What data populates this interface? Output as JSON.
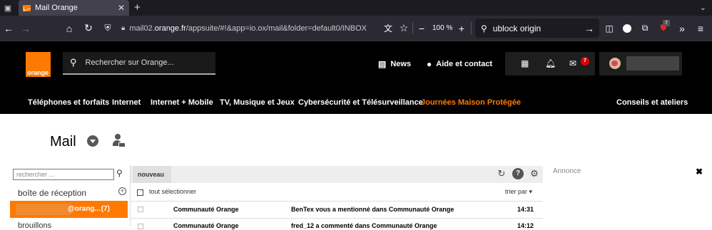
{
  "browser": {
    "tab_title": "Mail Orange",
    "tab_close": "✕",
    "new_tab": "+",
    "url_prefix": "mail02.",
    "url_domain": "orange.fr",
    "url_rest": "/appsuite/#!&app=io.ox/mail&folder=default0/INBOX",
    "zoom": "100 %",
    "search_text": "ublock origin",
    "ext_badge": "7"
  },
  "header": {
    "logo_text": "orange",
    "search_placeholder": "Rechercher sur Orange...",
    "news_label": "News",
    "help_label": "Aide et contact",
    "mail_count": "7"
  },
  "nav": {
    "items": [
      "Téléphones et forfaits",
      "Internet",
      "Internet + Mobile",
      "TV, Musique et Jeux",
      "Cybersécurité et Télésurveillance",
      "Journées Maison Protégée",
      "Conseils et ateliers"
    ]
  },
  "mail": {
    "title": "Mail",
    "folder_search_placeholder": "rechercher ...",
    "inbox_label": "boîte de réception",
    "account_suffix": "@orang...",
    "account_count": "(7)",
    "next_folder": "brouillons",
    "new_button": "nouveau",
    "select_all": "tout sélectionner",
    "sort_by": "trier par",
    "messages": [
      {
        "from": "Communauté Orange",
        "subject": "BenTex vous a mentionné dans Communauté Orange",
        "time": "14:31"
      },
      {
        "from": "Communauté Orange",
        "subject": "fred_12 a commenté dans Communauté Orange",
        "time": "14:12"
      }
    ],
    "ad_label": "Annonce"
  }
}
